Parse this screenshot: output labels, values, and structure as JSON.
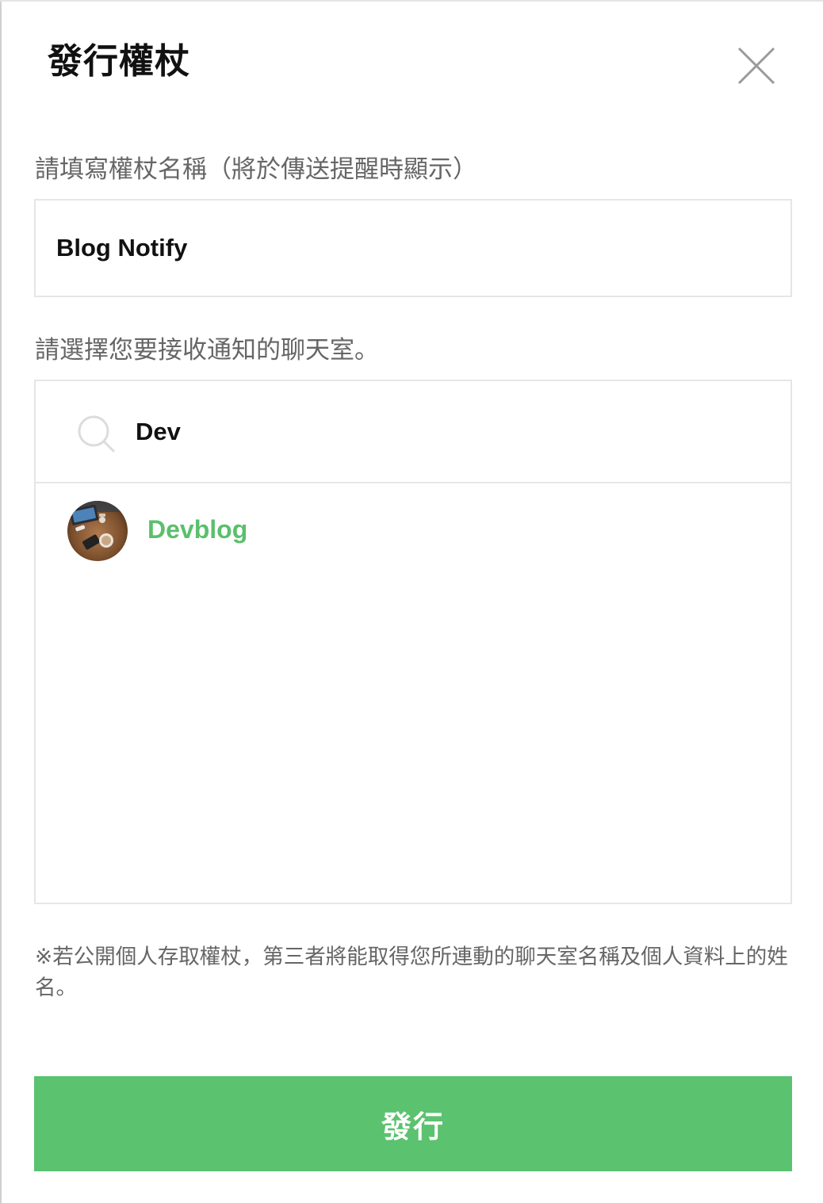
{
  "dialog": {
    "title": "發行權杖",
    "close_icon": "close-icon"
  },
  "token_name": {
    "label": "請填寫權杖名稱（將於傳送提醒時顯示）",
    "value": "Blog Notify"
  },
  "chat_room": {
    "label": "請選擇您要接收通知的聊天室。",
    "search_icon": "search-icon",
    "search_value": "Dev",
    "results": [
      {
        "name": "Devblog",
        "avatar": "group-avatar"
      }
    ]
  },
  "notice": "※若公開個人存取權杖，第三者將能取得您所連動的聊天室名稱及個人資料上的姓名。",
  "submit": {
    "label": "發行"
  },
  "colors": {
    "accent": "#5bc26f",
    "result_name": "#5bbf6c",
    "label_text": "#666666",
    "border": "#e6e6e6"
  }
}
